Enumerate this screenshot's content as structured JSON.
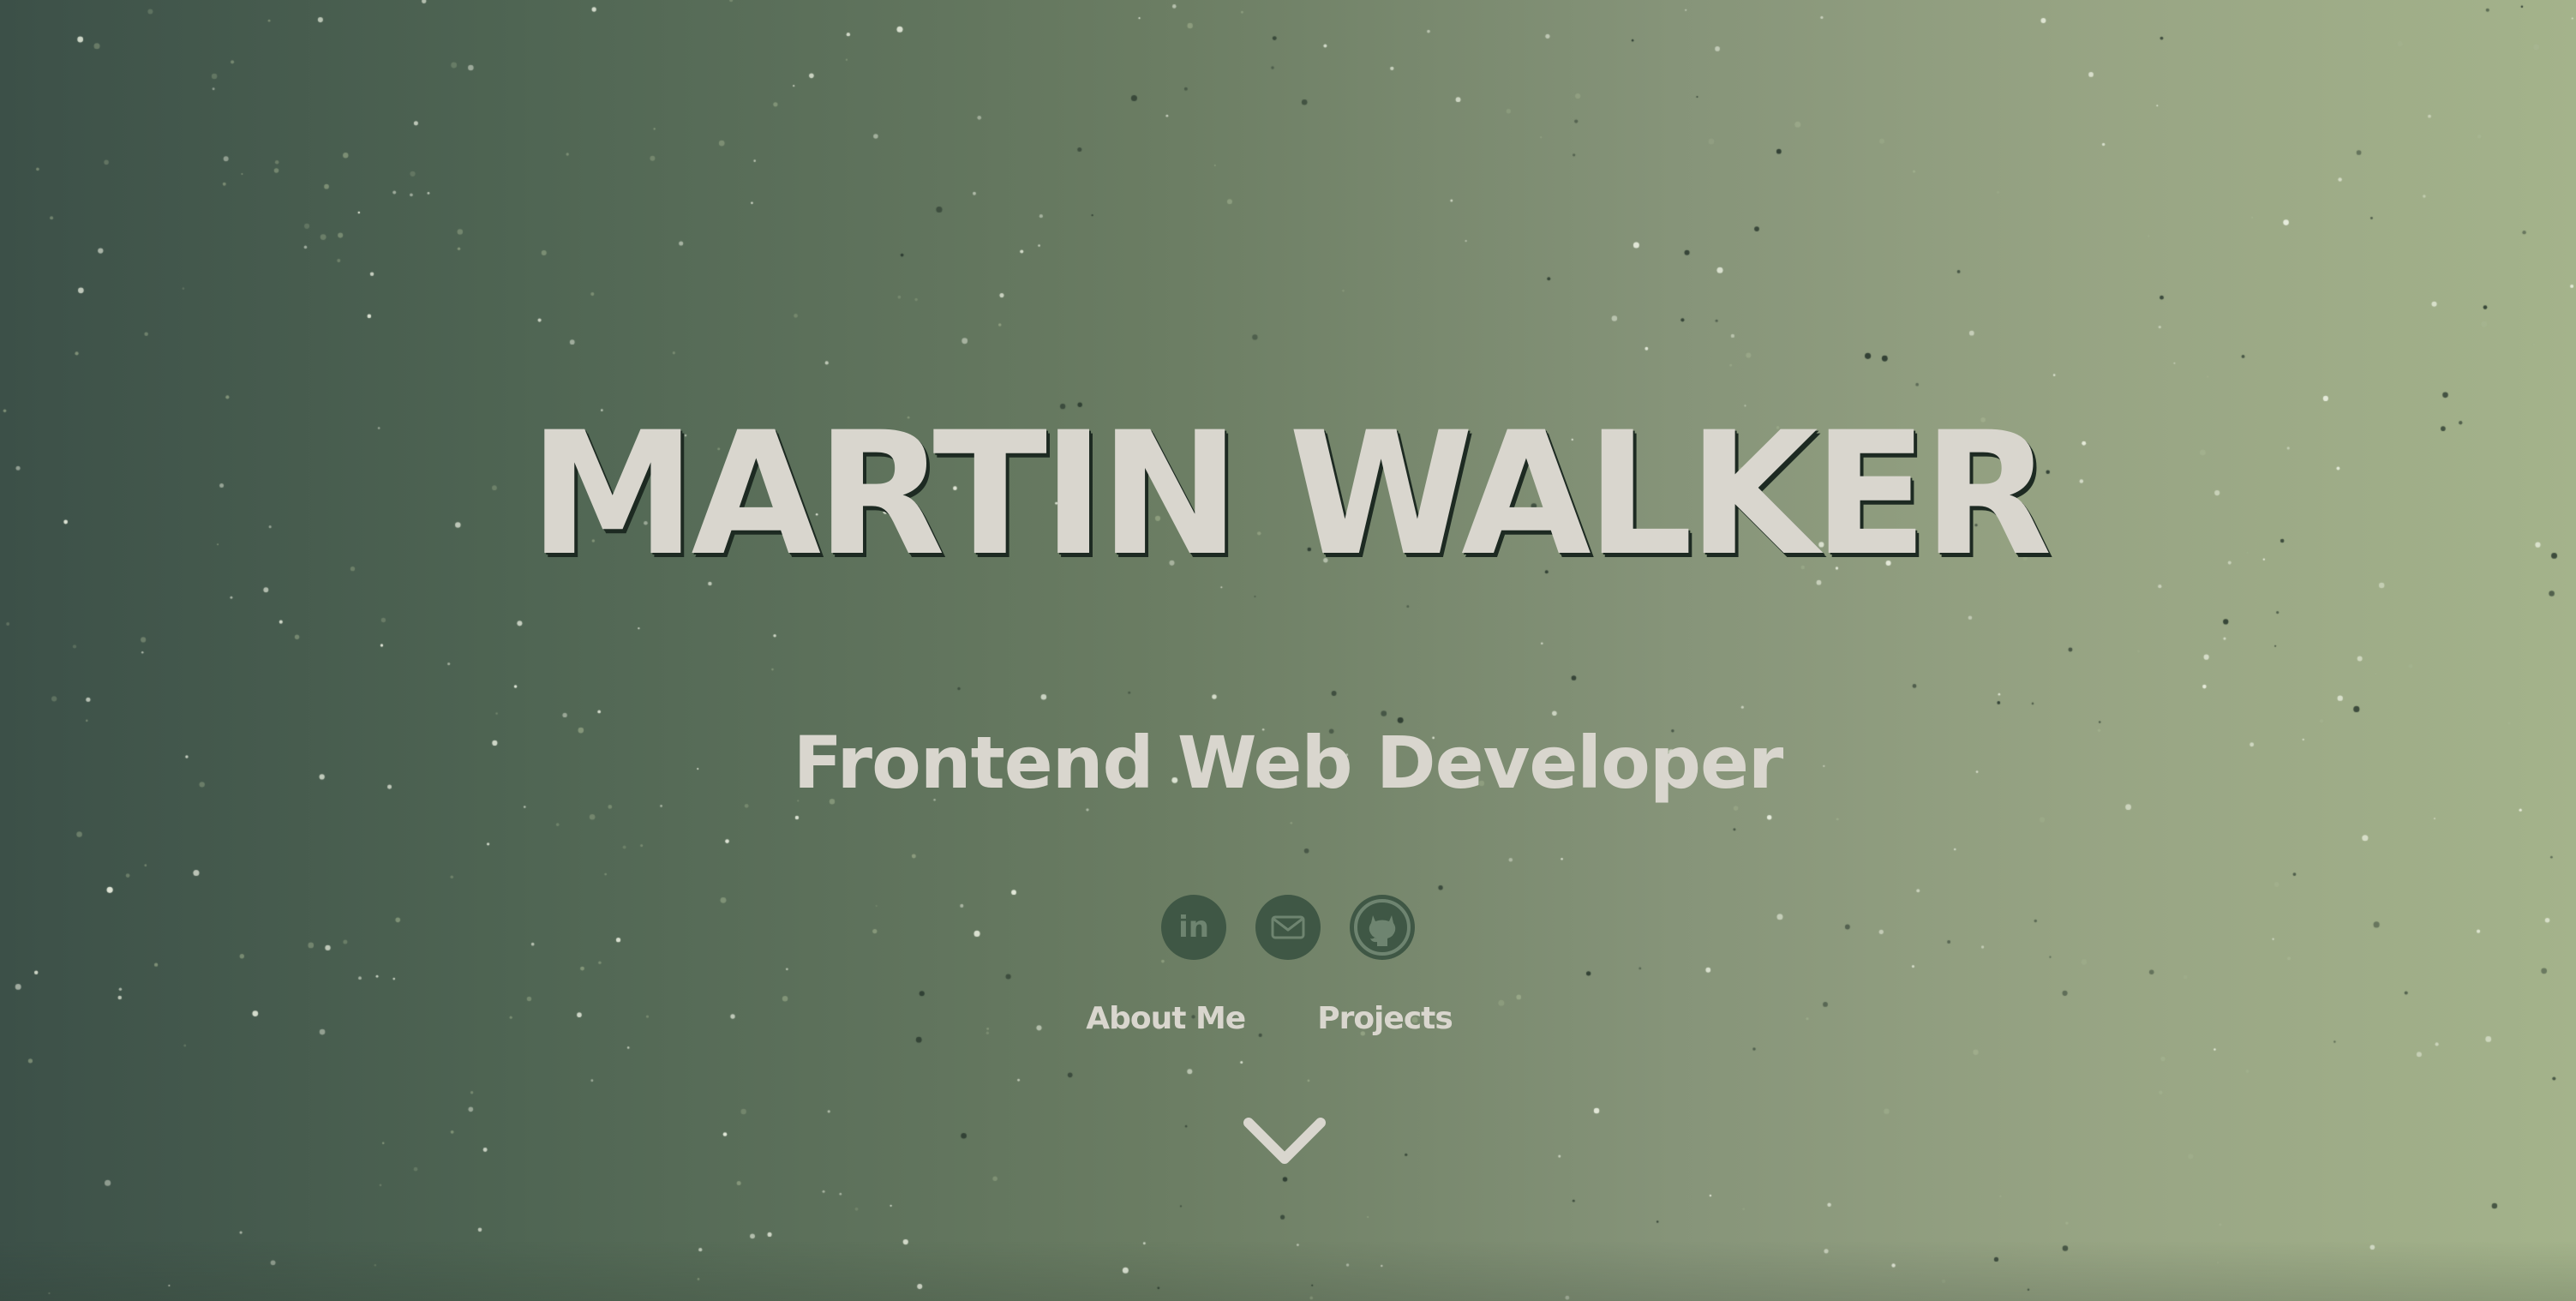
{
  "hero": {
    "name": "MARTIN WALKER",
    "subtitle": "Frontend Web Developer"
  },
  "socials": [
    {
      "label": "LinkedIn",
      "icon": "linkedin-icon",
      "glyph": "in"
    },
    {
      "label": "Email",
      "icon": "email-icon"
    },
    {
      "label": "GitHub",
      "icon": "github-icon"
    }
  ],
  "nav": {
    "about_label": "About Me",
    "projects_label": "Projects"
  },
  "scroll": {
    "icon": "chevron-down-icon"
  },
  "colors": {
    "background_start": "#3c5048",
    "background_end": "#a4b38b",
    "text": "#d9d6ce",
    "icon_circle": "#3f5745",
    "icon_glyph": "#6e8470"
  }
}
